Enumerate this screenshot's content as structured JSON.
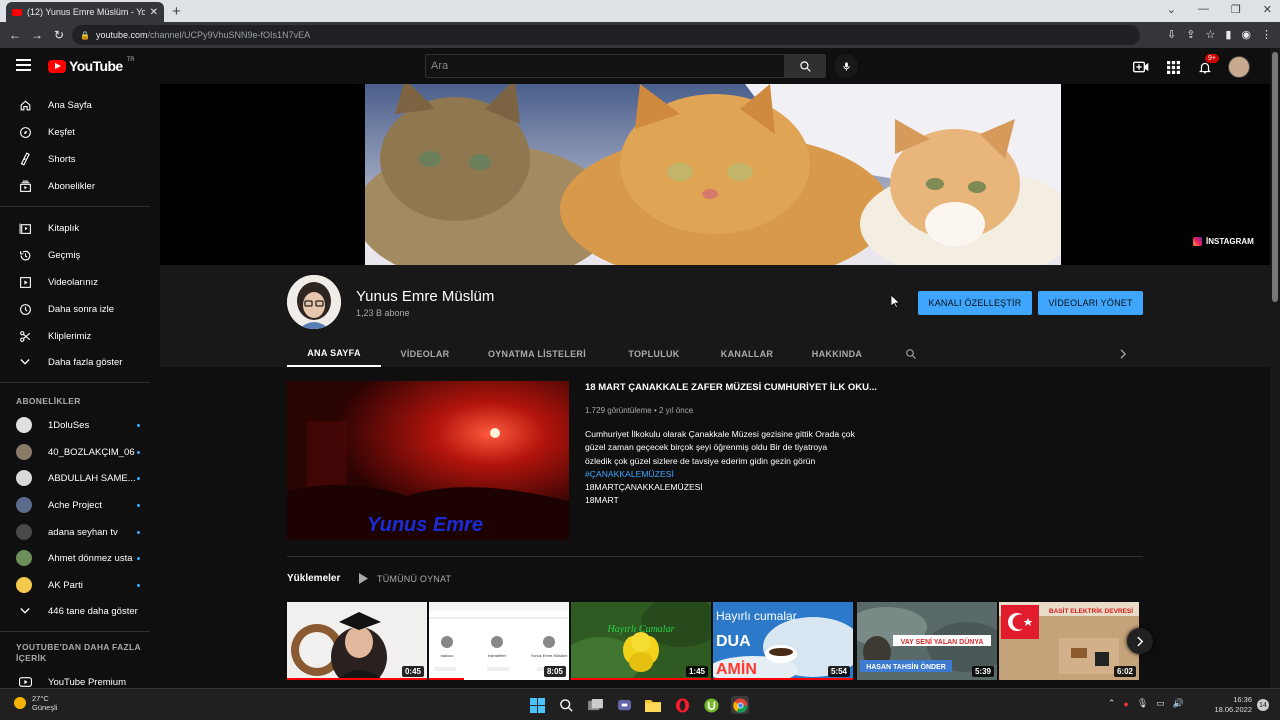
{
  "browser": {
    "tab_title": "(12) Yunus Emre Müslüm - YouTube",
    "url_host": "youtube.com",
    "url_path": "/channel/UCPy9VhuSNN9e-fOIs1N7vEA"
  },
  "header": {
    "logo_text": "YouTube",
    "logo_region": "TR",
    "search_placeholder": "Ara",
    "notification_count": "9+"
  },
  "sidebar": {
    "main": [
      {
        "label": "Ana Sayfa",
        "icon": "home-icon"
      },
      {
        "label": "Keşfet",
        "icon": "compass-icon"
      },
      {
        "label": "Shorts",
        "icon": "shorts-icon"
      },
      {
        "label": "Abonelikler",
        "icon": "subscriptions-icon"
      }
    ],
    "library": [
      {
        "label": "Kitaplık",
        "icon": "library-icon"
      },
      {
        "label": "Geçmiş",
        "icon": "history-icon"
      },
      {
        "label": "Videolarınız",
        "icon": "your-videos-icon"
      },
      {
        "label": "Daha sonra izle",
        "icon": "watch-later-icon"
      },
      {
        "label": "Kliplerimiz",
        "icon": "clips-icon"
      },
      {
        "label": "Daha fazla göster",
        "icon": "chevron-down-icon"
      }
    ],
    "subscriptions_heading": "ABONELİKLER",
    "subscriptions": [
      {
        "label": "1DoluSes",
        "color": "#e0e0e0"
      },
      {
        "label": "40_BOZLAKÇIM_06",
        "color": "#8a7a6a"
      },
      {
        "label": "ABDULLAH SAME...",
        "color": "#d8d8d8"
      },
      {
        "label": "Ache Project",
        "color": "#5a6b8c"
      },
      {
        "label": "adana seyhan tv",
        "color": "#4a4a4a"
      },
      {
        "label": "Ahmet dönmez usta",
        "color": "#6b8e5a"
      },
      {
        "label": "AK Parti",
        "color": "#f2c94c"
      }
    ],
    "show_more_subs": "446 tane daha göster",
    "more_heading": "YOUTUBE'DAN DAHA FAZLA İÇERİK",
    "premium": "YouTube Premium"
  },
  "banner": {
    "instagram_label": "İNSTAGRAM"
  },
  "channel": {
    "name": "Yunus Emre Müslüm",
    "subscribers": "1,23 B abone",
    "customize_button": "KANALI ÖZELLEŞTİR",
    "manage_videos_button": "VİDEOLARI YÖNET",
    "tabs": [
      "ANA SAYFA",
      "VİDEOLAR",
      "OYNATMA LİSTELERİ",
      "TOPLULUK",
      "KANALLAR",
      "HAKKINDA"
    ],
    "active_tab": "ANA SAYFA"
  },
  "featured": {
    "title": "18 MART ÇANAKKALE ZAFER MÜZESİ CUMHURİYET İLK OKU...",
    "meta": "1.729 görüntüleme • 2 yıl önce",
    "thumb_caption": "Yunus Emre",
    "description": "Cumhuriyet İlkokulu olarak Çanakkale Müzesi gezisine gittik Orada çok güzel zaman geçecek birçok şeyi öğrenmiş oldu Bir de tiyatroya özledik çok güzel sizlere de tavsiye ederim gidin gezin görün",
    "hashtag": "#ÇANAKKALEMÜZESİ",
    "tag_line_1": "18MARTÇANAKKALEMÜZESİ",
    "tag_line_2": "18MART"
  },
  "uploads": {
    "heading": "Yüklemeler",
    "play_all": "TÜMÜNÜ OYNAT",
    "videos": [
      {
        "duration": "0:45",
        "progress": 1.0
      },
      {
        "duration": "8:05",
        "progress": 0.25
      },
      {
        "duration": "1:45",
        "progress": 1.0
      },
      {
        "duration": "5:54",
        "progress": 1.0,
        "overlay_top": "Hayırlı cumalar",
        "overlay_mid": "DUA",
        "overlay_bot": "AMİN"
      },
      {
        "duration": "5:39",
        "progress": 0.0,
        "overlay_top": "VAY SENİ YALAN DÜNYA",
        "overlay_bot": "HASAN TAHSİN ÖNDER"
      },
      {
        "duration": "6:02",
        "progress": 0.0,
        "overlay_top": "BASİT ELEKTRİK DEVRESİ"
      }
    ],
    "mini_thumb": {
      "name": "Yunus Emre Müslüm",
      "left": "radiocc",
      "mid": "hamdefter"
    },
    "third_caption": "Hayırlı Cumalar"
  },
  "taskbar": {
    "temperature": "27°C",
    "weather": "Güneşli",
    "time": "16:36",
    "date": "18.06.2022",
    "notifications": "14"
  }
}
